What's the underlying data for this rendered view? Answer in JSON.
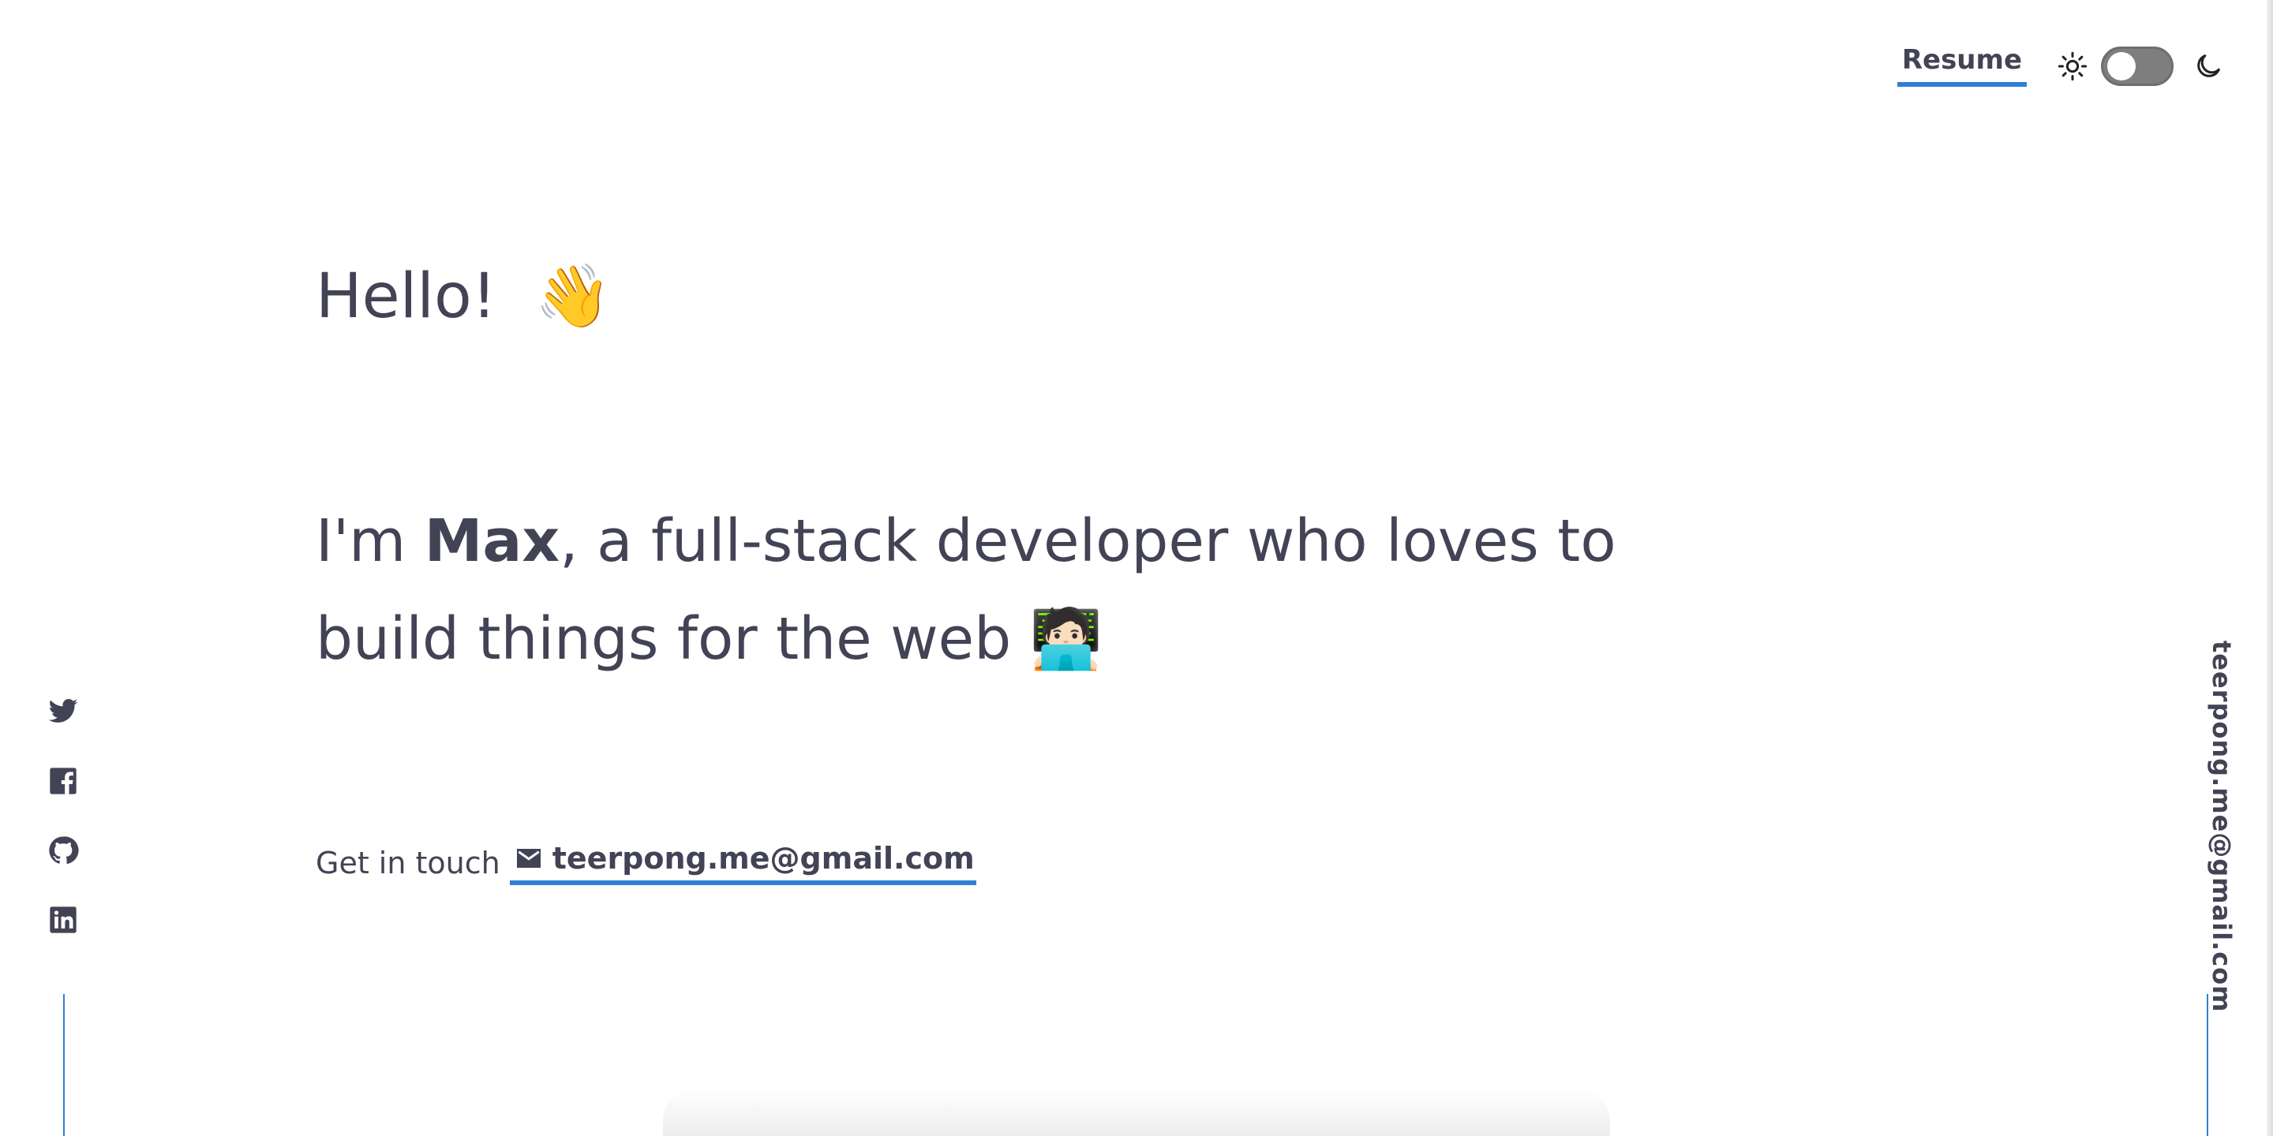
{
  "header": {
    "resume_label": "Resume",
    "light_icon": "sun-icon",
    "dark_icon": "moon-icon",
    "toggle_state": "off"
  },
  "hero": {
    "greeting": "Hello!",
    "greeting_emoji": "👋",
    "intro_prefix": "I'm ",
    "intro_name": "Max",
    "intro_suffix": ", a full-stack developer who loves to build things for the web",
    "intro_emoji": "🧑🏻‍💻"
  },
  "contact": {
    "label": "Get in touch",
    "email": "teerpong.me@gmail.com",
    "icon": "mail-icon"
  },
  "social": {
    "items": [
      {
        "icon": "twitter-icon"
      },
      {
        "icon": "facebook-icon"
      },
      {
        "icon": "github-icon"
      },
      {
        "icon": "linkedin-icon"
      }
    ]
  },
  "side_email": "teerpong.me@gmail.com",
  "colors": {
    "text": "#434356",
    "accent": "#2f80d5",
    "toggle": "#7e7e7e"
  }
}
